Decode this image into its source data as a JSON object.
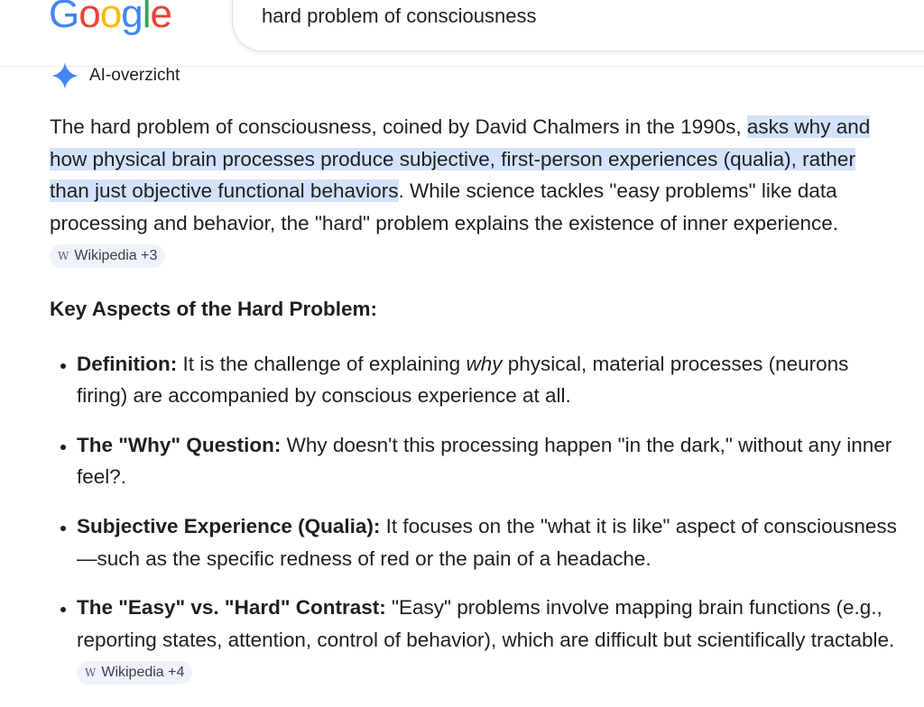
{
  "logo": {
    "letters": [
      "G",
      "o",
      "o",
      "g",
      "l",
      "e"
    ]
  },
  "search": {
    "query": "hard problem of consciousness"
  },
  "ai_overview": {
    "header_label": "AI-overzicht",
    "intro": {
      "part1": "The hard problem of consciousness, coined by David Chalmers in the 1990s, ",
      "highlight": "asks why and how physical brain processes produce subjective, first-person experiences (qualia), rather than just objective functional behaviors",
      "part2": ". While science tackles \"easy problems\" like data processing and behavior, the \"hard\" problem explains the existence of inner experience. ",
      "source_chip": "Wikipedia +3"
    },
    "key_heading": "Key Aspects of the Hard Problem:",
    "bullets": [
      {
        "term": "Definition:",
        "pre": " It is the challenge of explaining ",
        "em": "why",
        "post": " physical, material processes (neurons firing) are accompanied by conscious experience at all."
      },
      {
        "term": "The \"Why\" Question:",
        "text": " Why doesn't this processing happen \"in the dark,\" without any inner feel?."
      },
      {
        "term": "Subjective Experience (Qualia):",
        "text": " It focuses on the \"what it is like\" aspect of consciousness—such as the specific redness of red or the pain of a headache."
      },
      {
        "term": "The \"Easy\" vs. \"Hard\" Contrast:",
        "text": " \"Easy\" problems involve mapping brain functions (e.g., reporting states, attention, control of behavior), which are difficult but scientifically tractable. ",
        "source_chip": "Wikipedia +4"
      }
    ],
    "chip_icon_letter": "W"
  },
  "colors": {
    "highlight": "#d3e3fd",
    "chip_bg": "#eef2fb",
    "spark": "#4285f4"
  },
  "icons": {
    "ai_header": "gemini-spark-icon",
    "chip": "wikipedia-icon"
  }
}
